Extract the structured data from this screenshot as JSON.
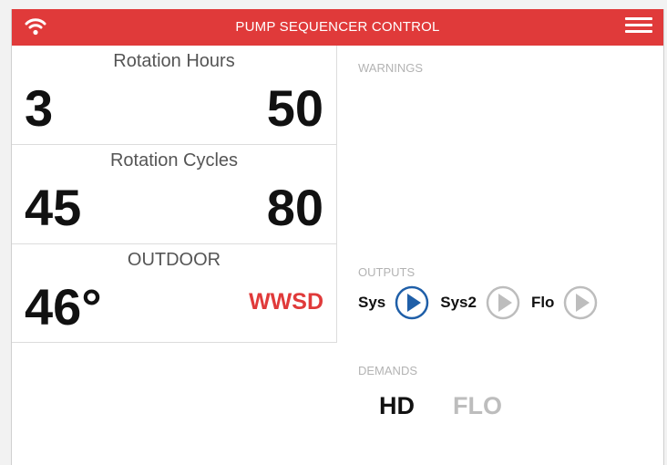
{
  "header": {
    "title": "PUMP SEQUENCER CONTROL",
    "bg_color": "#e03a3a",
    "left_icon": "wifi-icon",
    "right_icon": "hamburger-menu-icon"
  },
  "rotation_hours": {
    "label": "Rotation Hours",
    "left_value": "3",
    "right_value": "50"
  },
  "rotation_cycles": {
    "label": "Rotation Cycles",
    "left_value": "45",
    "right_value": "80"
  },
  "outdoor": {
    "label": "OUTDOOR",
    "temperature": "46°",
    "status": "WWSD",
    "status_color": "#e03a3a"
  },
  "warnings": {
    "label": "WARNINGS"
  },
  "outputs": {
    "label": "OUTPUTS",
    "items": [
      {
        "name": "Sys",
        "state": "active",
        "icon": "play-icon",
        "color": "#1f5fa8"
      },
      {
        "name": "Sys2",
        "state": "inactive",
        "icon": "play-icon",
        "color": "#bdbdbd"
      },
      {
        "name": "Flo",
        "state": "inactive",
        "icon": "play-icon",
        "color": "#bdbdbd"
      }
    ]
  },
  "demands": {
    "label": "DEMANDS",
    "items": [
      {
        "name": "HD",
        "state": "active"
      },
      {
        "name": "FLO",
        "state": "inactive"
      }
    ]
  }
}
